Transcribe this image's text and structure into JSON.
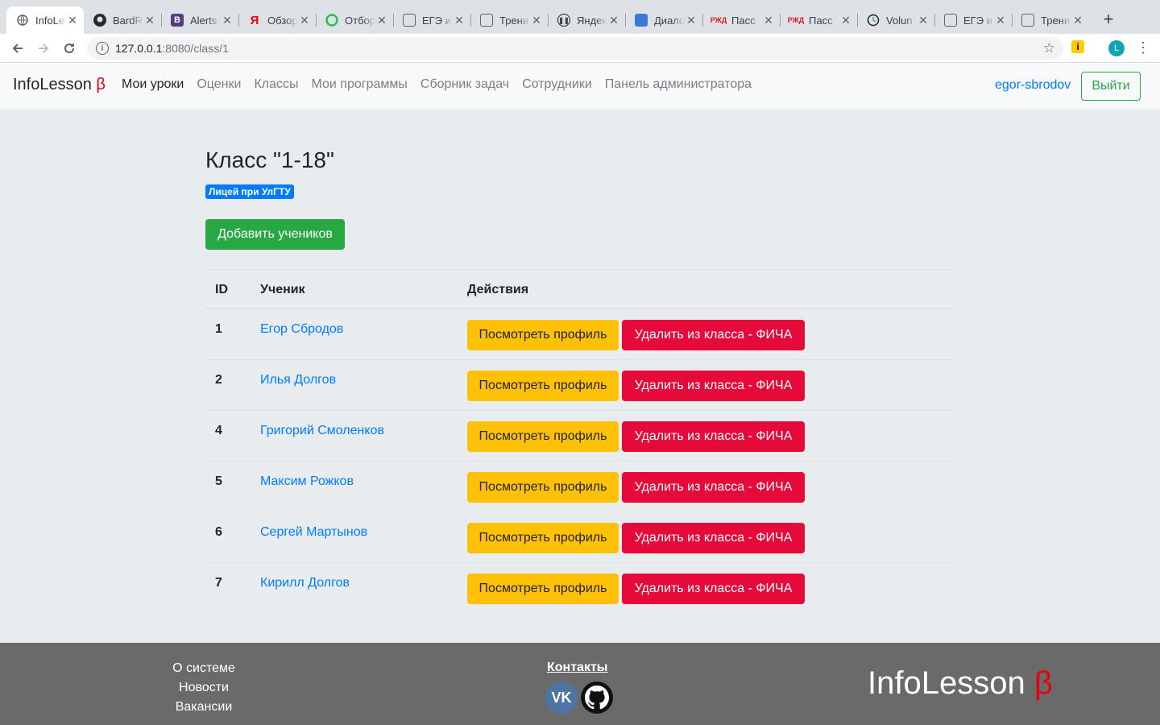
{
  "browser": {
    "tabs": [
      {
        "label": "InfoLesson",
        "icon": "globe-icon"
      },
      {
        "label": "BardRoll",
        "icon": "github-icon"
      },
      {
        "label": "Alerts",
        "icon": "bootstrap-icon"
      },
      {
        "label": "Обзор",
        "icon": "yandex-icon"
      },
      {
        "label": "Отбор",
        "icon": "green-circle-icon"
      },
      {
        "label": "ЕГЭ и",
        "icon": "edit-icon"
      },
      {
        "label": "Трени",
        "icon": "edit-icon"
      },
      {
        "label": "Яндекс",
        "icon": "pause-icon"
      },
      {
        "label": "Диалоги",
        "icon": "chat-icon"
      },
      {
        "label": "Пасс",
        "icon": "rzd-icon"
      },
      {
        "label": "Пасс",
        "icon": "rzd-icon"
      },
      {
        "label": "Volun",
        "icon": "clock-icon"
      },
      {
        "label": "ЕГЭ и",
        "icon": "edit-icon"
      },
      {
        "label": "Трени",
        "icon": "edit-icon"
      }
    ],
    "url_host": "127.0.0.1",
    "url_rest": ":8080/class/1",
    "profile_initial": "L"
  },
  "navbar": {
    "brand": "InfoLesson",
    "beta": "β",
    "links": [
      {
        "label": "Мои уроки",
        "active": true
      },
      {
        "label": "Оценки"
      },
      {
        "label": "Классы"
      },
      {
        "label": "Мои программы"
      },
      {
        "label": "Сборник задач"
      },
      {
        "label": "Сотрудники"
      },
      {
        "label": "Панель администратора"
      }
    ],
    "username": "egor-sbrodov",
    "logout_label": "Выйти"
  },
  "main": {
    "title": "Класс \"1-18\"",
    "school_badge": "Лицей при УлГТУ",
    "add_button": "Добавить учеников",
    "table": {
      "headers": {
        "id": "ID",
        "student": "Ученик",
        "actions": "Действия"
      },
      "view_label": "Посмотреть профиль",
      "delete_label": "Удалить из класса - ФИЧА",
      "rows": [
        {
          "id": "1",
          "name": "Егор Сбродов"
        },
        {
          "id": "2",
          "name": "Илья Долгов"
        },
        {
          "id": "4",
          "name": "Григорий Смоленков"
        },
        {
          "id": "5",
          "name": "Максим Рожков"
        },
        {
          "id": "6",
          "name": "Сергей Мартынов"
        },
        {
          "id": "7",
          "name": "Кирилл Долгов"
        }
      ]
    }
  },
  "footer": {
    "links": [
      "О системе",
      "Новости",
      "Вакансии"
    ],
    "contacts": "Контакты",
    "vk_label": "VK",
    "brand": "InfoLesson",
    "beta": "β"
  },
  "colors": {
    "primary": "#007bff",
    "success": "#28a745",
    "warning": "#ffc107",
    "danger": "#e60a3b",
    "footer_bg": "#6a6a6a",
    "beta": "#e60012"
  }
}
